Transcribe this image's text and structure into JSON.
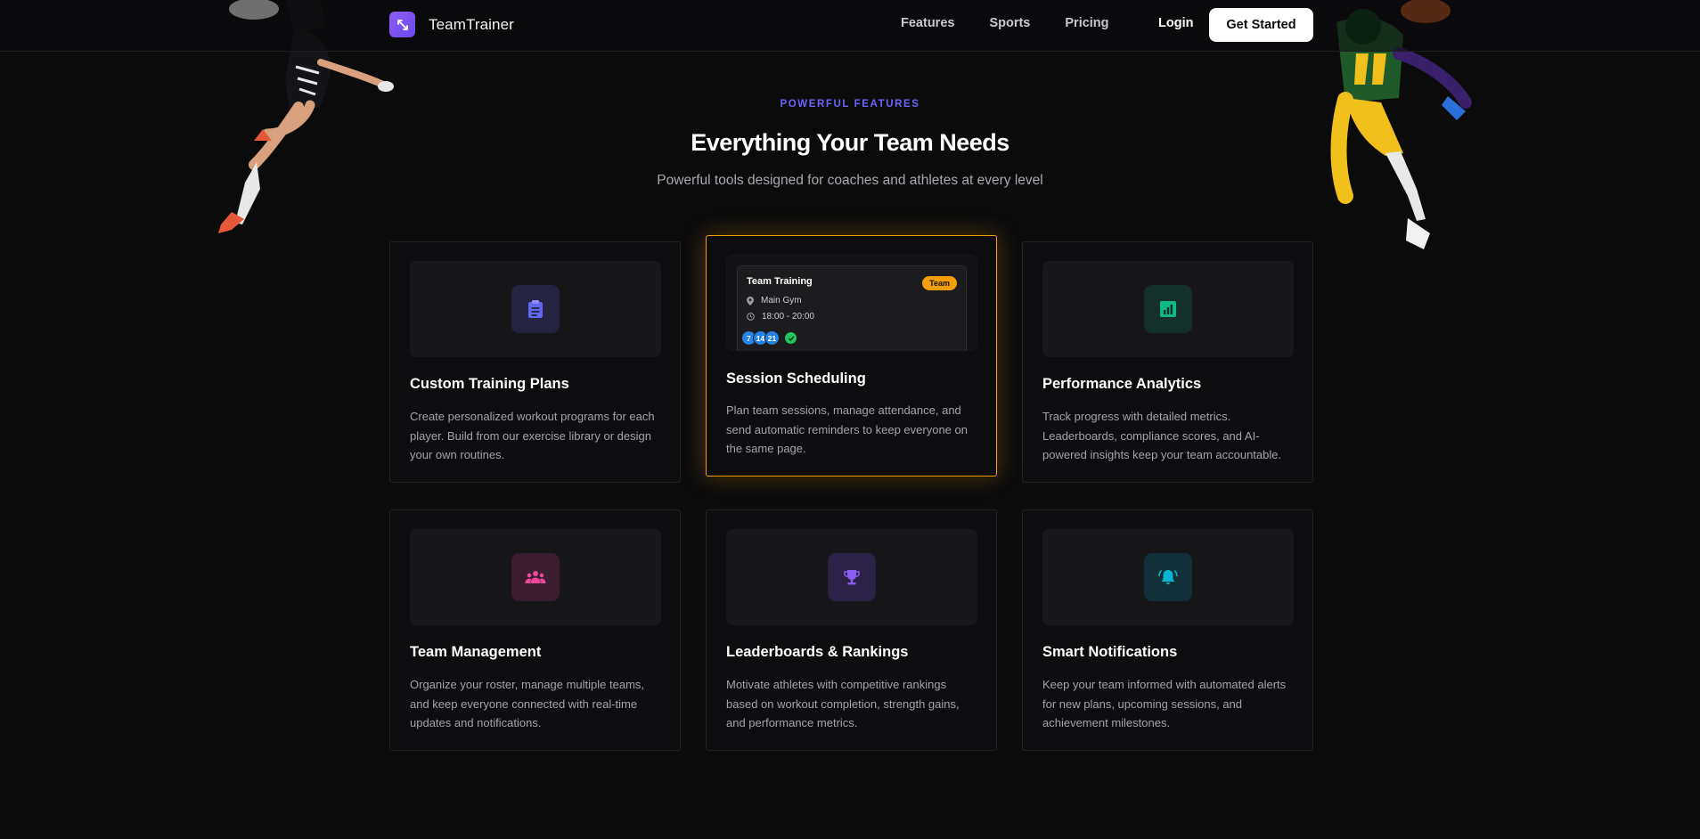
{
  "nav": {
    "brand": "TeamTrainer",
    "links": [
      "Features",
      "Sports",
      "Pricing"
    ],
    "login": "Login",
    "cta": "Get Started"
  },
  "header": {
    "eyebrow": "POWERFUL FEATURES",
    "title": "Everything Your Team Needs",
    "subtitle": "Powerful tools designed for coaches and athletes at every level"
  },
  "colors": {
    "accent": "#6c63ff",
    "featured_border": "#f59e0b",
    "background": "#0b0b0c"
  },
  "features": [
    {
      "title": "Custom Training Plans",
      "description": "Create personalized workout programs for each player. Build from our exercise library or design your own routines.",
      "icon": "clipboard-icon",
      "color": "#6366f1"
    },
    {
      "title": "Session Scheduling",
      "description": "Plan team sessions, manage attendance, and send automatic reminders to keep everyone on the same page.",
      "preview": {
        "title": "Team Training",
        "badge": "Team",
        "location": "Main Gym",
        "time": "18:00 - 20:00",
        "avatars": [
          "7",
          "14",
          "21"
        ]
      }
    },
    {
      "title": "Performance Analytics",
      "description": "Track progress with detailed metrics. Leaderboards, compliance scores, and AI-powered insights keep your team accountable.",
      "icon": "analytics-icon",
      "color": "#10b981"
    },
    {
      "title": "Team Management",
      "description": "Organize your roster, manage multiple teams, and keep everyone connected with real-time updates and notifications.",
      "icon": "group-icon",
      "color": "#ec4899"
    },
    {
      "title": "Leaderboards & Rankings",
      "description": "Motivate athletes with competitive rankings based on workout completion, strength gains, and performance metrics.",
      "icon": "trophy-icon",
      "color": "#8b5cf6"
    },
    {
      "title": "Smart Notifications",
      "description": "Keep your team informed with automated alerts for new plans, upcoming sessions, and achievement milestones.",
      "icon": "bell-icon",
      "color": "#06b6d4"
    }
  ]
}
